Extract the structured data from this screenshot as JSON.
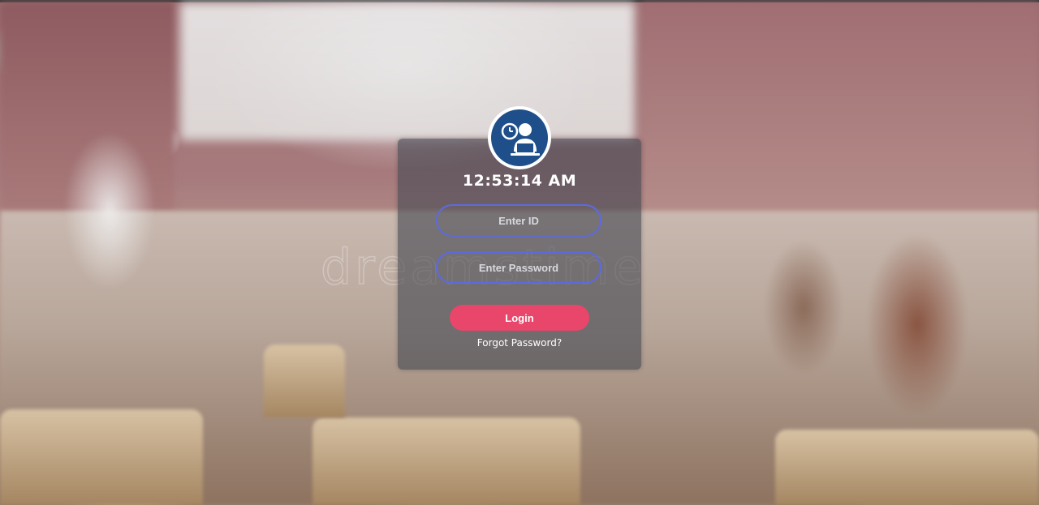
{
  "background": {
    "watermark_text": "dreamstime"
  },
  "login_card": {
    "clock": "12:53:14 AM",
    "id_field": {
      "placeholder": "Enter ID",
      "value": ""
    },
    "password_field": {
      "placeholder": "Enter Password",
      "value": ""
    },
    "login_label": "Login",
    "forgot_label": "Forgot Password?"
  },
  "colors": {
    "field_border": "#5c6ae0",
    "login_button": "#e8466a",
    "avatar_circle": "#1f4f8a",
    "card_background": "rgba(70,72,82,0.62)"
  },
  "icons": {
    "avatar": "user-at-laptop-with-clock-icon"
  }
}
